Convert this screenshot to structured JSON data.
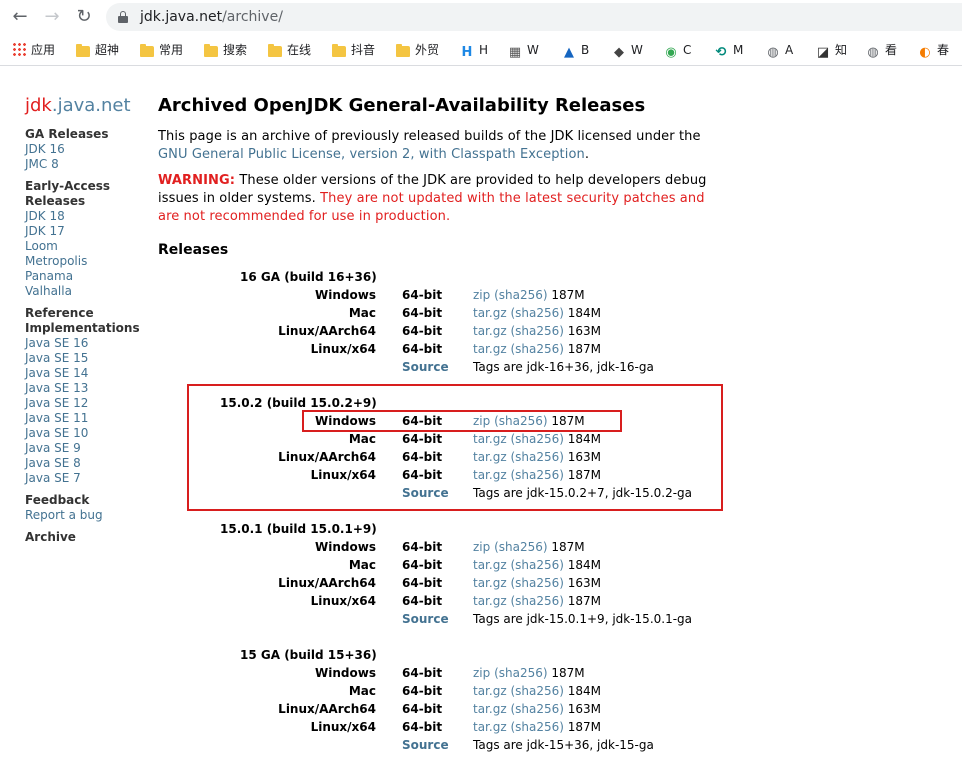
{
  "browser": {
    "url_host": "jdk.java.net",
    "url_path": "/archive/",
    "nav": {
      "back": "←",
      "forward": "→",
      "reload": "↻"
    },
    "bookmarks": [
      {
        "label": "应用",
        "icon": "apps-grid-icon"
      },
      {
        "label": "超神",
        "icon": "folder-icon"
      },
      {
        "label": "常用",
        "icon": "folder-icon"
      },
      {
        "label": "搜索",
        "icon": "folder-icon"
      },
      {
        "label": "在线",
        "icon": "folder-icon"
      },
      {
        "label": "抖音",
        "icon": "folder-icon"
      },
      {
        "label": "外贸",
        "icon": "folder-icon"
      },
      {
        "label": "H",
        "icon": "h-logo-icon",
        "icon_text": "H",
        "color": "#1e88e5"
      },
      {
        "label": "W",
        "icon": "w-grid-icon",
        "icon_text": "▦",
        "color": "#555555"
      },
      {
        "label": "B",
        "icon": "flame-icon",
        "icon_text": "▲",
        "color": "#1565c0"
      },
      {
        "label": "W",
        "icon": "fox-icon",
        "icon_text": "◆",
        "color": "#444444"
      },
      {
        "label": "C",
        "icon": "c-circle-icon",
        "icon_text": "◉",
        "color": "#34a853"
      },
      {
        "label": "M",
        "icon": "m-circle-icon",
        "icon_text": "⟲",
        "color": "#00897b"
      },
      {
        "label": "A",
        "icon": "globe-icon",
        "icon_text": "◍",
        "color": "#5f6368"
      },
      {
        "label": "知",
        "icon": "zhi-logo-icon",
        "icon_text": "◪",
        "color": "#333333"
      },
      {
        "label": "看",
        "icon": "globe-icon",
        "icon_text": "◍",
        "color": "#5f6368"
      },
      {
        "label": "春",
        "icon": "orange-logo-icon",
        "icon_text": "◐",
        "color": "#f57c00"
      }
    ]
  },
  "logo": {
    "jdk": "jdk",
    "rest": ".java.net"
  },
  "sidebar": {
    "ga_head": "GA Releases",
    "ga_links": [
      "JDK 16",
      "JMC 8"
    ],
    "ea_head": "Early-Access Releases",
    "ea_links": [
      "JDK 18",
      "JDK 17",
      "Loom",
      "Metropolis",
      "Panama",
      "Valhalla"
    ],
    "ri_head": "Reference Implementations",
    "ri_links": [
      "Java SE 16",
      "Java SE 15",
      "Java SE 14",
      "Java SE 13",
      "Java SE 12",
      "Java SE 11",
      "Java SE 10",
      "Java SE 9",
      "Java SE 8",
      "Java SE 7"
    ],
    "fb_head": "Feedback",
    "fb_link": "Report a bug",
    "archive": "Archive"
  },
  "main": {
    "title": "Archived OpenJDK General-Availability Releases",
    "intro": "This page is an archive of previously released builds of the JDK licensed under the",
    "intro_link": "GNU General Public License, version 2, with Classpath Exception",
    "intro_end": ".",
    "warning_label": "WARNING:",
    "warning_text": " These older versions of the JDK are provided to help developers debug issues in older systems. ",
    "warning_red": "They are not updated with the latest security patches and are not recommended for use in production.",
    "releases_head": "Releases"
  },
  "releases": [
    {
      "title": "16 GA (build 16+36)",
      "rows": [
        {
          "os": "Windows",
          "arch": "64-bit",
          "pkg": "zip",
          "sha": "sha256",
          "size": "187M"
        },
        {
          "os": "Mac",
          "arch": "64-bit",
          "pkg": "tar.gz",
          "sha": "sha256",
          "size": "184M"
        },
        {
          "os": "Linux/AArch64",
          "arch": "64-bit",
          "pkg": "tar.gz",
          "sha": "sha256",
          "size": "163M"
        },
        {
          "os": "Linux/x64",
          "arch": "64-bit",
          "pkg": "tar.gz",
          "sha": "sha256",
          "size": "187M"
        }
      ],
      "source": "Source",
      "tags": "Tags are jdk-16+36, jdk-16-ga"
    },
    {
      "title": "15.0.2 (build 15.0.2+9)",
      "rows": [
        {
          "os": "Windows",
          "arch": "64-bit",
          "pkg": "zip",
          "sha": "sha256",
          "size": "187M"
        },
        {
          "os": "Mac",
          "arch": "64-bit",
          "pkg": "tar.gz",
          "sha": "sha256",
          "size": "184M"
        },
        {
          "os": "Linux/AArch64",
          "arch": "64-bit",
          "pkg": "tar.gz",
          "sha": "sha256",
          "size": "163M"
        },
        {
          "os": "Linux/x64",
          "arch": "64-bit",
          "pkg": "tar.gz",
          "sha": "sha256",
          "size": "187M"
        }
      ],
      "source": "Source",
      "tags": "Tags are jdk-15.0.2+7, jdk-15.0.2-ga"
    },
    {
      "title": "15.0.1 (build 15.0.1+9)",
      "rows": [
        {
          "os": "Windows",
          "arch": "64-bit",
          "pkg": "zip",
          "sha": "sha256",
          "size": "187M"
        },
        {
          "os": "Mac",
          "arch": "64-bit",
          "pkg": "tar.gz",
          "sha": "sha256",
          "size": "184M"
        },
        {
          "os": "Linux/AArch64",
          "arch": "64-bit",
          "pkg": "tar.gz",
          "sha": "sha256",
          "size": "163M"
        },
        {
          "os": "Linux/x64",
          "arch": "64-bit",
          "pkg": "tar.gz",
          "sha": "sha256",
          "size": "187M"
        }
      ],
      "source": "Source",
      "tags": "Tags are jdk-15.0.1+9, jdk-15.0.1-ga"
    },
    {
      "title": "15 GA (build 15+36)",
      "rows": [
        {
          "os": "Windows",
          "arch": "64-bit",
          "pkg": "zip",
          "sha": "sha256",
          "size": "187M"
        },
        {
          "os": "Mac",
          "arch": "64-bit",
          "pkg": "tar.gz",
          "sha": "sha256",
          "size": "184M"
        },
        {
          "os": "Linux/AArch64",
          "arch": "64-bit",
          "pkg": "tar.gz",
          "sha": "sha256",
          "size": "163M"
        },
        {
          "os": "Linux/x64",
          "arch": "64-bit",
          "pkg": "tar.gz",
          "sha": "sha256",
          "size": "187M"
        }
      ],
      "source": "Source",
      "tags": "Tags are jdk-15+36, jdk-15-ga"
    }
  ],
  "colors": {
    "accent_red": "#e11f1f",
    "link": "#437291",
    "annotation": "#d81e1e"
  }
}
